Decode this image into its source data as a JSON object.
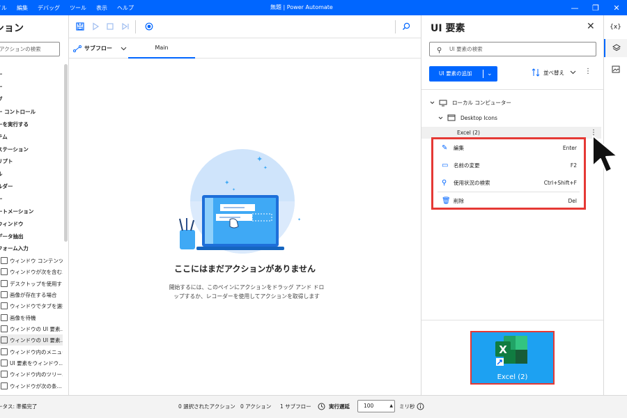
{
  "titlebar": {
    "menu": [
      "イル",
      "編集",
      "デバッグ",
      "ツール",
      "表示",
      "ヘルプ"
    ],
    "title": "無題 | Power Automate",
    "minimize": "—",
    "restore": "❐",
    "close": "✕"
  },
  "actions_panel": {
    "title": "ション",
    "search_placeholder": "アクションの検索",
    "categories": [
      "ー",
      "ー",
      "ブ",
      "ー コントロール",
      "ーを実行する",
      "テム",
      "ステーション",
      "リプト",
      "ル",
      "ルダー",
      "ー",
      "ートメーション",
      "ウィンドウ",
      "データ抽出",
      "フォーム入力"
    ],
    "items": [
      "ウィンドウ コンテンツ...",
      "ウィンドウが次を含む...",
      "デスクトップを使用する",
      "画像が存在する場合",
      "ウィンドウでタブを選択",
      "画像を待機",
      "ウィンドウの UI 要素...",
      "ウィンドウの UI 要素...",
      "ウィンドウ内のメニュー...",
      "UI 要素をウィンドウ...",
      "ウィンドウ内のツリー...",
      "ウィンドウが次の条..."
    ]
  },
  "toolbar": {
    "subflow_label": "サブフロー",
    "main_tab": "Main"
  },
  "canvas": {
    "empty_title": "ここにはまだアクションがありません",
    "empty_desc": "開始するには、このペインにアクションをドラッグ アンド ドロップするか、レコーダーを使用してアクションを取得します"
  },
  "ui_panel": {
    "title": "UI 要素",
    "search_placeholder": "UI 要素の検索",
    "add_button": "UI 要素の追加",
    "sort_label": "並べ替え",
    "tree_root": "ローカル コンピューター",
    "tree_window": "Desktop Icons",
    "tree_element": "Excel (2)",
    "preview_label": "Excel (2)"
  },
  "context_menu": {
    "items": [
      {
        "label": "編集",
        "key": "Enter",
        "icon": "pencil-icon"
      },
      {
        "label": "名前の変更",
        "key": "F2",
        "icon": "rename-icon"
      },
      {
        "label": "使用状況の検索",
        "key": "Ctrl+Shift+F",
        "icon": "search-icon"
      },
      {
        "label": "削除",
        "key": "Del",
        "icon": "trash-icon"
      }
    ]
  },
  "rail": {
    "variables": "{x}"
  },
  "statusbar": {
    "status": "ータス: 準備完了",
    "selected_actions": "0 選択されたアクション",
    "actions_count": "0 アクション",
    "subflows_count": "1 サブフロー",
    "run_delay_label": "実行遅延",
    "run_delay_value": "100",
    "unit": "ミリ秒"
  },
  "colors": {
    "accent": "#0066ff",
    "highlight_border": "#e53935",
    "preview_bg": "#1da1f2",
    "excel_green": "#107c41"
  }
}
